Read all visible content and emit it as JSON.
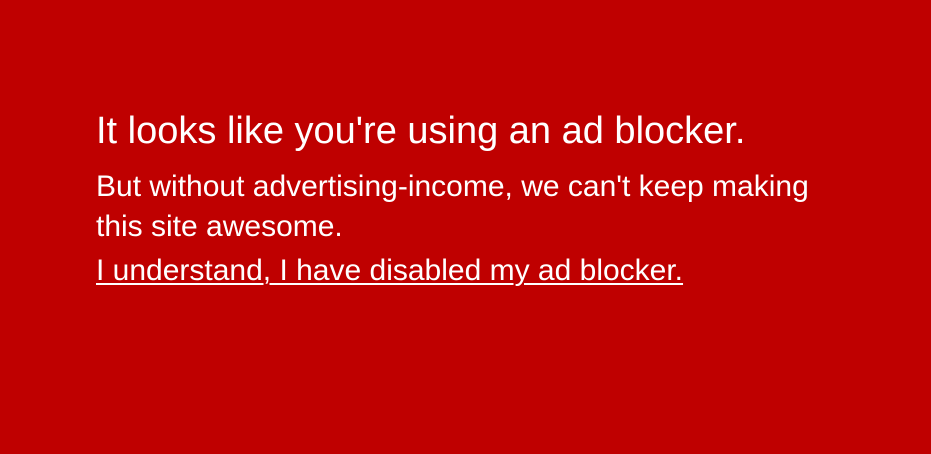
{
  "adblock_notice": {
    "headline": "It looks like you're using an ad blocker.",
    "message": "But without advertising-income, we can't keep making this site awesome.",
    "dismiss_link": "I understand, I have disabled my ad blocker.",
    "background_color": "#bf0000",
    "text_color": "#ffffff"
  }
}
